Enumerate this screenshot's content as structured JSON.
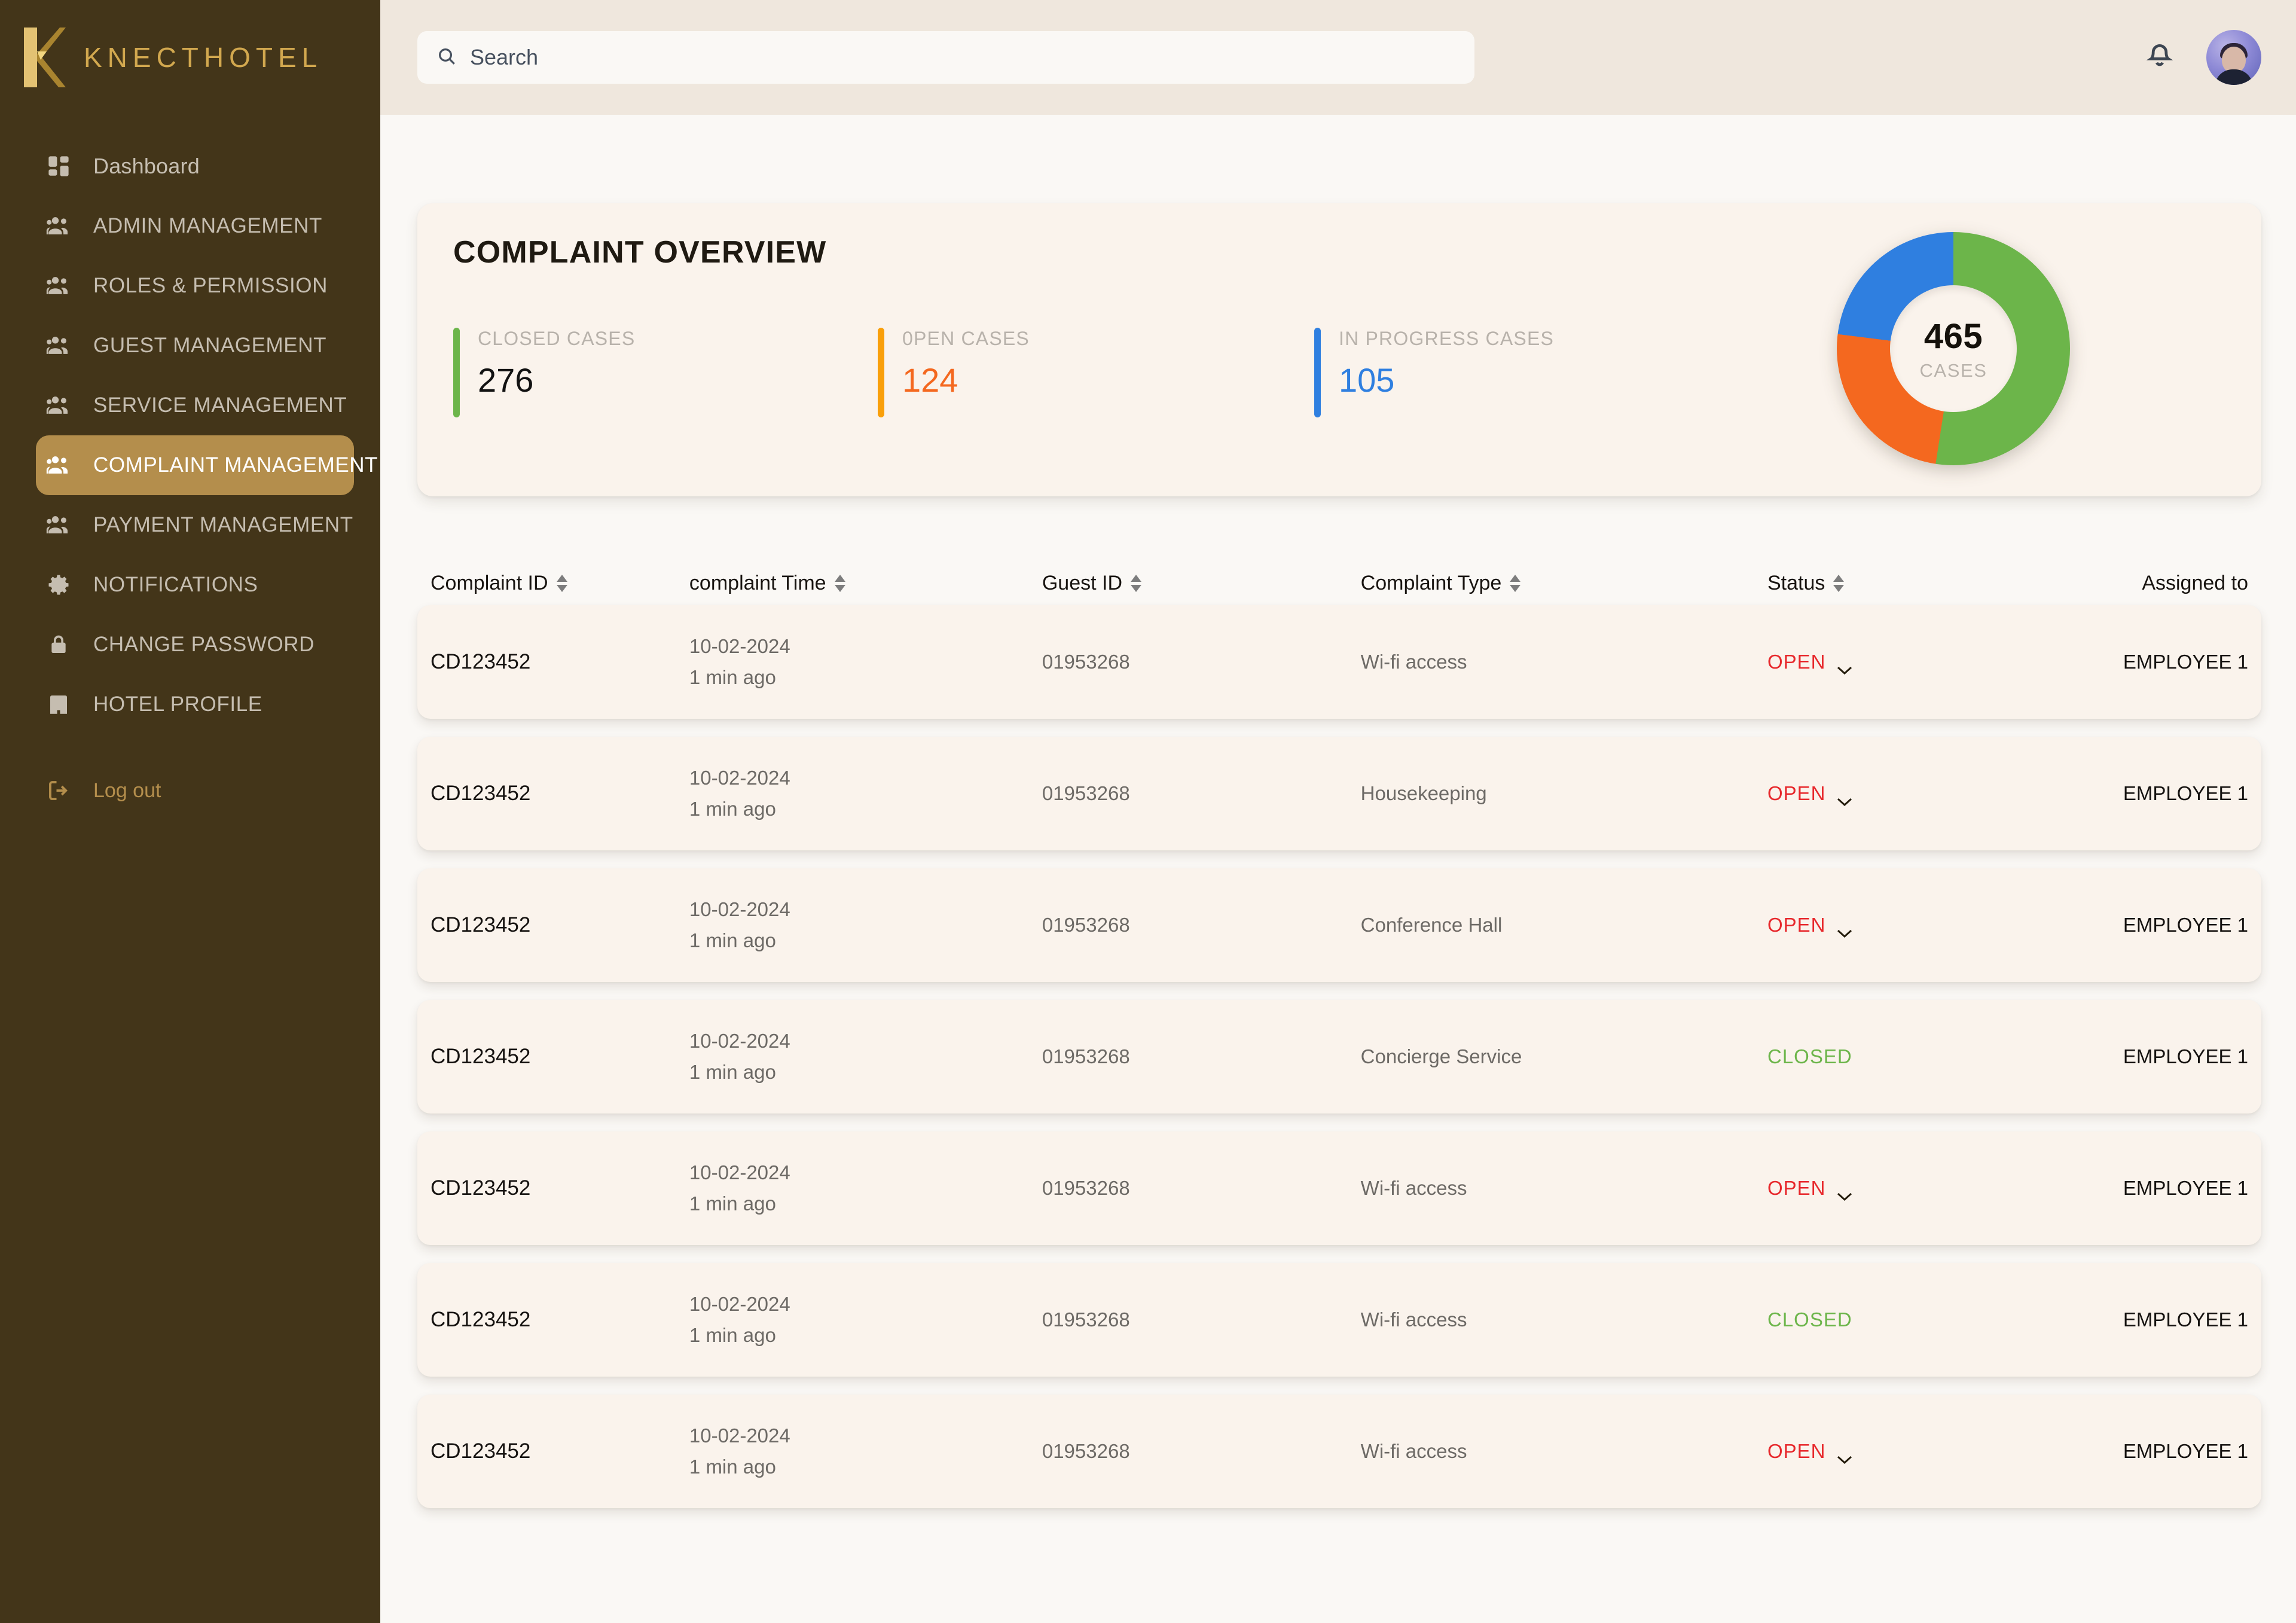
{
  "brand": {
    "name": "KNECTHOTEL",
    "logo_icon": "knect-k-logo"
  },
  "sidebar": {
    "items": [
      {
        "label": "Dashboard",
        "icon": "dashboard-grid-icon",
        "active": false
      },
      {
        "label": "ADMIN MANAGEMENT",
        "icon": "people-icon",
        "active": false
      },
      {
        "label": "ROLES & PERMISSION",
        "icon": "people-icon",
        "active": false
      },
      {
        "label": "GUEST MANAGEMENT",
        "icon": "people-icon",
        "active": false
      },
      {
        "label": "SERVICE MANAGEMENT",
        "icon": "people-icon",
        "active": false
      },
      {
        "label": "COMPLAINT MANAGEMENT",
        "icon": "people-icon",
        "active": true
      },
      {
        "label": "PAYMENT MANAGEMENT",
        "icon": "people-icon",
        "active": false
      },
      {
        "label": "NOTIFICATIONS",
        "icon": "gear-icon",
        "active": false
      },
      {
        "label": "CHANGE PASSWORD",
        "icon": "lock-icon",
        "active": false
      },
      {
        "label": "HOTEL PROFILE",
        "icon": "hotel-building-icon",
        "active": false
      }
    ],
    "logout": {
      "label": "Log out",
      "icon": "logout-icon"
    },
    "colors": {
      "background": "#433519",
      "active": "#b48e4c",
      "accent": "#d2a84f",
      "text": "#c5bdb0"
    }
  },
  "topbar": {
    "search": {
      "placeholder": "Search",
      "value": "",
      "icon": "search-icon"
    },
    "notifications_icon": "bell-icon",
    "avatar": "user-avatar"
  },
  "overview": {
    "title": "COMPLAINT OVERVIEW",
    "stats": [
      {
        "label": "CLOSED CASES",
        "value": "276",
        "bar_color": "#6cb54a",
        "value_color": "#121212"
      },
      {
        "label": "0PEN CASES",
        "value": "124",
        "bar_color": "#f99f0a",
        "value_color": "#f4681f"
      },
      {
        "label": "IN PROGRESS CASES",
        "value": "105",
        "bar_color": "#2f7fe0",
        "value_color": "#2f7fe0"
      }
    ],
    "donut": {
      "total": "465",
      "unit": "CASES"
    }
  },
  "chart_data": {
    "type": "pie",
    "title": "Complaint Overview",
    "labels": [
      "Closed cases",
      "0pen cases",
      "In progress cases"
    ],
    "values": [
      276,
      124,
      105
    ],
    "total": 465,
    "colors": [
      "#6cb54a",
      "#f4681f",
      "#2f7fe0"
    ],
    "legend": "left",
    "center_label": "465",
    "center_sublabel": "CASES",
    "donut": true,
    "hole_fraction": 0.54
  },
  "table": {
    "columns": [
      {
        "key": "id",
        "label": "Complaint ID",
        "sortable": true
      },
      {
        "key": "time",
        "label": "complaint Time",
        "sortable": true
      },
      {
        "key": "guest",
        "label": "Guest  ID",
        "sortable": true
      },
      {
        "key": "type",
        "label": "Complaint Type",
        "sortable": true
      },
      {
        "key": "status",
        "label": "Status",
        "sortable": true
      },
      {
        "key": "assigned",
        "label": "Assigned to",
        "sortable": false
      }
    ],
    "rows": [
      {
        "id": "CD123452",
        "date": "10-02-2024",
        "ago": "1 min ago",
        "guest": "01953268",
        "type": "Wi-fi access",
        "status": "OPEN",
        "status_kind": "open",
        "assigned": "EMPLOYEE 1"
      },
      {
        "id": "CD123452",
        "date": "10-02-2024",
        "ago": "1 min ago",
        "guest": "01953268",
        "type": "Housekeeping",
        "status": "OPEN",
        "status_kind": "open",
        "assigned": "EMPLOYEE 1"
      },
      {
        "id": "CD123452",
        "date": "10-02-2024",
        "ago": "1 min ago",
        "guest": "01953268",
        "type": "Conference Hall",
        "status": "OPEN",
        "status_kind": "open",
        "assigned": "EMPLOYEE 1"
      },
      {
        "id": "CD123452",
        "date": "10-02-2024",
        "ago": "1 min ago",
        "guest": "01953268",
        "type": "Concierge Service",
        "status": "CLOSED",
        "status_kind": "closed",
        "assigned": "EMPLOYEE 1"
      },
      {
        "id": "CD123452",
        "date": "10-02-2024",
        "ago": "1 min ago",
        "guest": "01953268",
        "type": "Wi-fi access",
        "status": "OPEN",
        "status_kind": "open",
        "assigned": "EMPLOYEE 1"
      },
      {
        "id": "CD123452",
        "date": "10-02-2024",
        "ago": "1 min ago",
        "guest": "01953268",
        "type": "Wi-fi access",
        "status": "CLOSED",
        "status_kind": "closed",
        "assigned": "EMPLOYEE 1"
      },
      {
        "id": "CD123452",
        "date": "10-02-2024",
        "ago": "1 min ago",
        "guest": "01953268",
        "type": "Wi-fi access",
        "status": "OPEN",
        "status_kind": "open",
        "assigned": "EMPLOYEE 1"
      }
    ]
  }
}
